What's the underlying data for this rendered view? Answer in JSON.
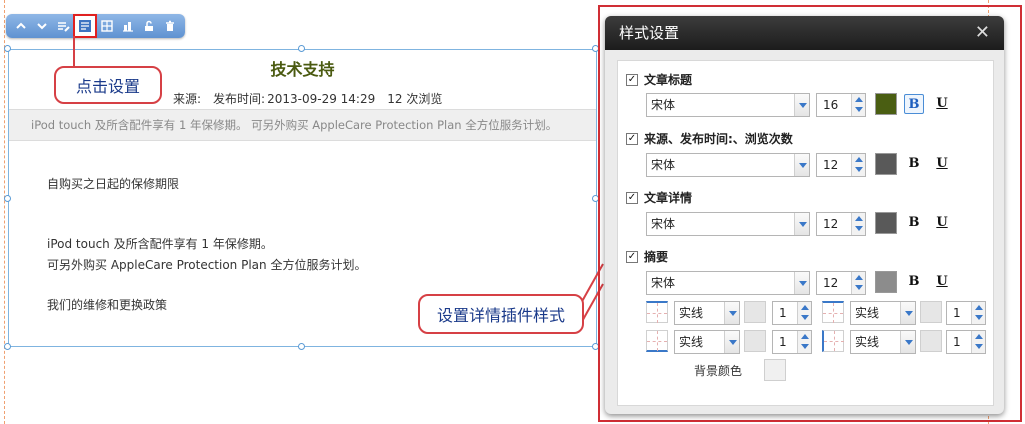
{
  "toolbar": {
    "buttons": [
      "chevron-up-icon",
      "chevron-down-icon",
      "edit-icon",
      "settings-icon",
      "table-icon",
      "chart-icon",
      "unlock-icon",
      "trash-icon"
    ]
  },
  "article": {
    "title": "技术支持",
    "meta": {
      "source_label": "来源:",
      "publish_label": "发布时间:",
      "publish_time": "2013-09-29 14:29",
      "views": "12 次浏览"
    },
    "summary": "iPod touch 及所含配件享有 1 年保修期。 可另外购买 AppleCare Protection Plan 全方位服务计划。",
    "detail_lines": [
      "自购买之日起的保修期限",
      "iPod touch 及所含配件享有 1 年保修期。",
      "可另外购买 AppleCare Protection Plan 全方位服务计划。",
      "我们的维修和更换政策"
    ]
  },
  "callouts": {
    "click_settings": "点击设置",
    "set_detail_style": "设置详情插件样式"
  },
  "dialog": {
    "title": "样式设置",
    "close": "✕",
    "sections": [
      {
        "label": "文章标题",
        "checked": true,
        "font": "宋体",
        "size": "16",
        "color": "#4a5e12",
        "bold_active": true
      },
      {
        "label": "来源、发布时间:、浏览次数",
        "checked": true,
        "font": "宋体",
        "size": "12",
        "color": "#595959",
        "bold_active": false
      },
      {
        "label": "文章详情",
        "checked": true,
        "font": "宋体",
        "size": "12",
        "color": "#595959",
        "bold_active": false
      },
      {
        "label": "摘要",
        "checked": true,
        "font": "宋体",
        "size": "12",
        "color": "#8c8c8c",
        "bold_active": false
      }
    ],
    "bold_label": "B",
    "underline_label": "U",
    "check_mark": "✓",
    "borders": [
      {
        "style": "实线",
        "width": "1"
      },
      {
        "style": "实线",
        "width": "1"
      },
      {
        "style": "实线",
        "width": "1"
      },
      {
        "style": "实线",
        "width": "1"
      }
    ],
    "background_label": "背景颜色"
  }
}
